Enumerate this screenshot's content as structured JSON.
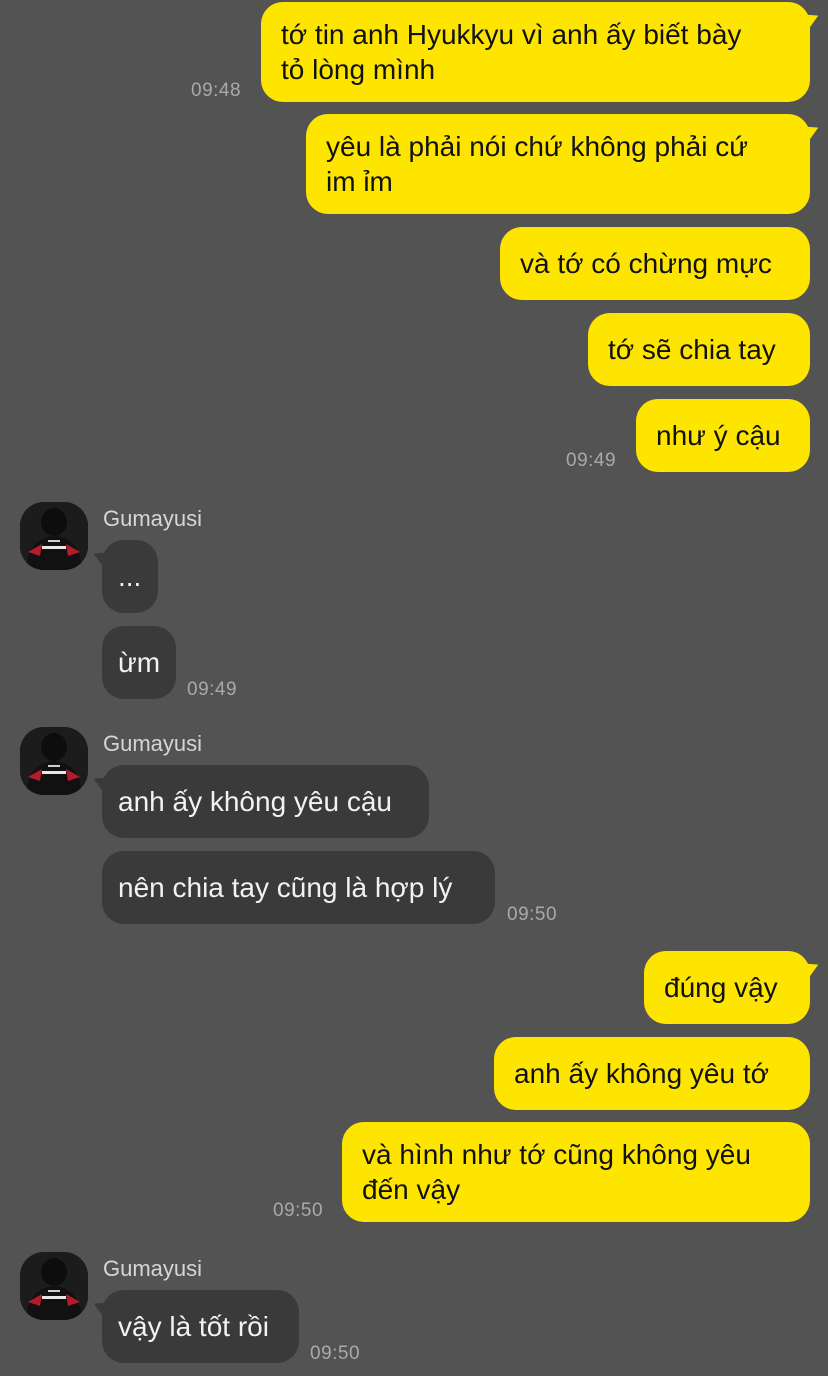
{
  "colors": {
    "background": "#535353",
    "my_bubble": "#fee500",
    "their_bubble": "#3a3a3a",
    "timestamp": "#a9a9a9"
  },
  "messages": {
    "m1": {
      "text_line1": "tớ tin anh Hyukkyu vì anh ấy biết bày",
      "text_line2": "tỏ lòng mình",
      "time": "09:48"
    },
    "m2": {
      "text_line1": "yêu là phải nói chứ không phải cứ",
      "text_line2": "im ỉm"
    },
    "m3": {
      "text": "và tớ có chừng mực"
    },
    "m4": {
      "text": "tớ sẽ chia tay"
    },
    "m5": {
      "text": "như ý cậu",
      "time": "09:49"
    },
    "g1": {
      "sender": "Gumayusi",
      "avatar_icon": "profile-photo-icon"
    },
    "m6": {
      "text": "..."
    },
    "m7": {
      "text": "ừm",
      "time": "09:49"
    },
    "g2": {
      "sender": "Gumayusi",
      "avatar_icon": "profile-photo-icon"
    },
    "m8": {
      "text": "anh ấy không yêu cậu"
    },
    "m9": {
      "text": "nên chia tay cũng là hợp lý",
      "time": "09:50"
    },
    "m10": {
      "text": "đúng vậy"
    },
    "m11": {
      "text": "anh ấy không yêu tớ"
    },
    "m12": {
      "text_line1": "và hình như tớ cũng không yêu",
      "text_line2": "đến vậy",
      "time": "09:50"
    },
    "g3": {
      "sender": "Gumayusi",
      "avatar_icon": "profile-photo-icon"
    },
    "m13": {
      "text": "vậy là tốt rồi",
      "time": "09:50"
    }
  }
}
